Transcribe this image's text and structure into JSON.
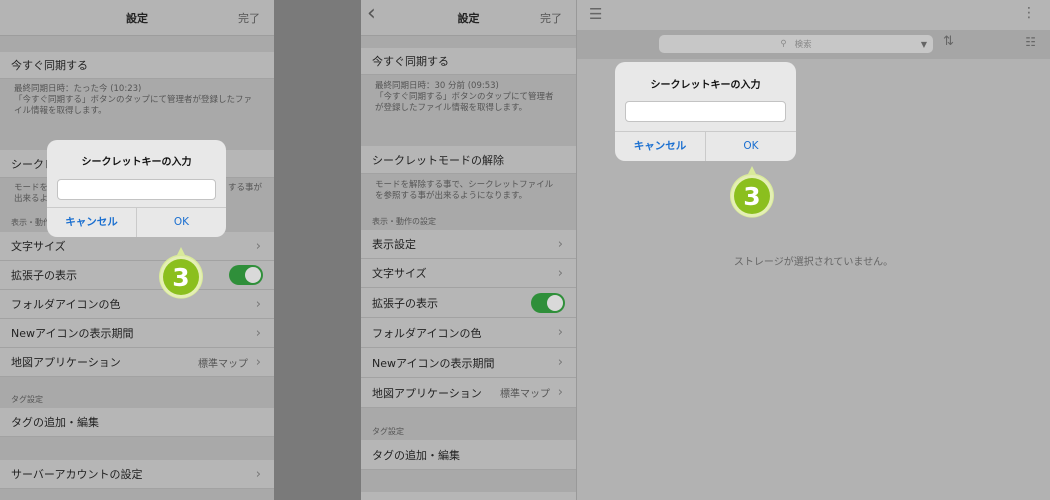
{
  "left": {
    "nav": {
      "title": "設定",
      "done": "完了"
    },
    "sync_label": "今すぐ同期する",
    "sync_note_1": "最終同期日時：たった今 (10:23)",
    "sync_note_2": "「今すぐ同期する」ボタンのタップにて管理者が登録したファ",
    "sync_note_3": "イル情報を取得します。",
    "secret_label": "シークレ",
    "secret_note_1": "モードを",
    "secret_note_1r": "する事が",
    "secret_note_2": "出来るよ",
    "display_section": "表示・動作",
    "rows": {
      "font_size": "文字サイズ",
      "extension": "拡張子の表示",
      "folder_color": "フォルダアイコンの色",
      "new_icon": "Newアイコンの表示期間",
      "map_app": "地図アプリケーション",
      "map_value": "標準マップ",
      "tag_add": "タグの追加・編集",
      "server": "サーバーアカウントの設定"
    },
    "tag_section": "タグ設定",
    "dialog": {
      "title": "シークレットキーの入力",
      "cancel": "キャンセル",
      "ok": "OK"
    },
    "badge": "3"
  },
  "mid": {
    "nav": {
      "title": "設定",
      "done": "完了",
      "back": "‹"
    },
    "sync_label": "今すぐ同期する",
    "sync_note_1": "最終同期日時：30 分前 (09:53)",
    "sync_note_2": "「今すぐ同期する」ボタンのタップにて管理者",
    "sync_note_3": "が登録したファイル情報を取得します。",
    "secret_label": "シークレットモードの解除",
    "secret_note_1": "モードを解除する事で、シークレットファイル",
    "secret_note_2": "を参照する事が出来るようになります。",
    "display_section": "表示・動作の設定",
    "rows": {
      "display": "表示設定",
      "font_size": "文字サイズ",
      "extension": "拡張子の表示",
      "folder_color": "フォルダアイコンの色",
      "new_icon": "Newアイコンの表示期間",
      "map_app": "地図アプリケーション",
      "map_value": "標準マップ",
      "tag_add": "タグの追加・編集"
    },
    "tag_section": "タグ設定"
  },
  "right": {
    "search_placeholder": "検索",
    "empty_message": "ストレージが選択されていません。",
    "dialog": {
      "title": "シークレットキーの入力",
      "cancel": "キャンセル",
      "ok": "OK"
    },
    "badge": "3"
  },
  "colors": {
    "badge_green": "#8bbf1e",
    "link_blue": "#1a6fd0",
    "toggle_green": "#2f8f3a"
  }
}
